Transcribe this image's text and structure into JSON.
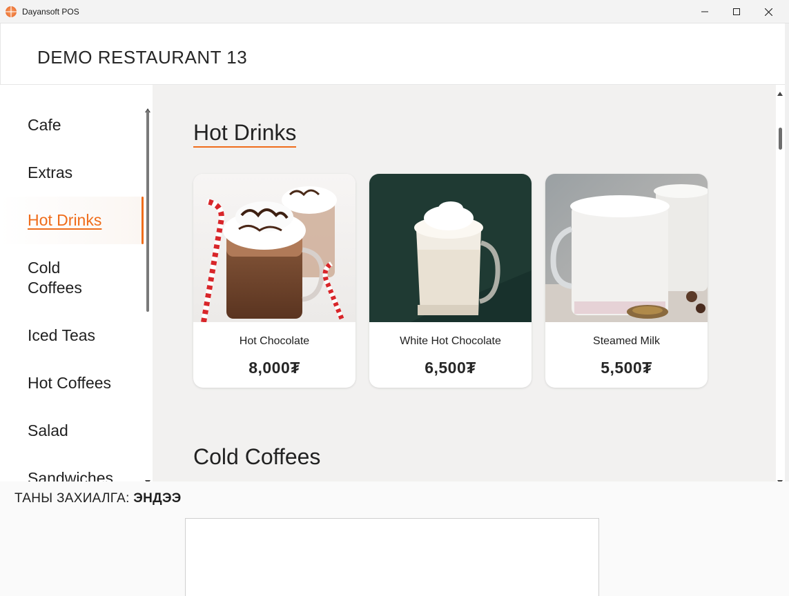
{
  "window": {
    "title": "Dayansoft POS",
    "controls": {
      "minimize": "minimize-icon",
      "maximize": "maximize-icon",
      "close": "close-icon"
    }
  },
  "header": {
    "restaurant_name": "DEMO RESTAURANT 13"
  },
  "sidebar": {
    "items": [
      {
        "label": "Cafe",
        "active": false
      },
      {
        "label": "Extras",
        "active": false
      },
      {
        "label": "Hot Drinks",
        "active": true
      },
      {
        "label": "Cold Coffees",
        "active": false
      },
      {
        "label": "Iced Teas",
        "active": false
      },
      {
        "label": "Hot Coffees",
        "active": false
      },
      {
        "label": "Salad",
        "active": false
      },
      {
        "label": "Sandwiches",
        "active": false
      }
    ]
  },
  "main": {
    "sections": [
      {
        "title": "Hot Drinks",
        "products": [
          {
            "name": "Hot Chocolate",
            "price": "8,000₮",
            "image": "hot-chocolate-photo"
          },
          {
            "name": "White Hot Chocolate",
            "price": "6,500₮",
            "image": "white-hot-chocolate-photo"
          },
          {
            "name": "Steamed Milk",
            "price": "5,500₮",
            "image": "steamed-milk-photo"
          }
        ]
      },
      {
        "title": "Cold Coffees",
        "products": []
      }
    ]
  },
  "order": {
    "label": "ТАНЫ ЗАХИАЛГА:",
    "table": "ЭНДЭЭ"
  },
  "colors": {
    "accent": "#ef6c1a",
    "content_bg": "#f2f1f0",
    "card_bg": "#ffffff",
    "white_chocolate_bg": "#1f3a33"
  }
}
